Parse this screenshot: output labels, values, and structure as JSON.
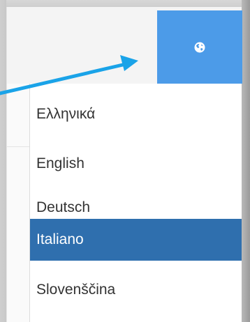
{
  "header": {
    "language_button_icon": "globe-icon",
    "language_button_color": "#4c9be8"
  },
  "language_menu": {
    "items": [
      {
        "label": "Ελληνικά",
        "selected": false
      },
      {
        "label": "English",
        "selected": false
      },
      {
        "label": "Deutsch",
        "selected": false
      },
      {
        "label": "Italiano",
        "selected": true
      },
      {
        "label": "Slovenščina",
        "selected": false
      }
    ],
    "selected_color": "#2f6fae"
  },
  "annotation": {
    "arrow_color": "#1aa3e8"
  }
}
